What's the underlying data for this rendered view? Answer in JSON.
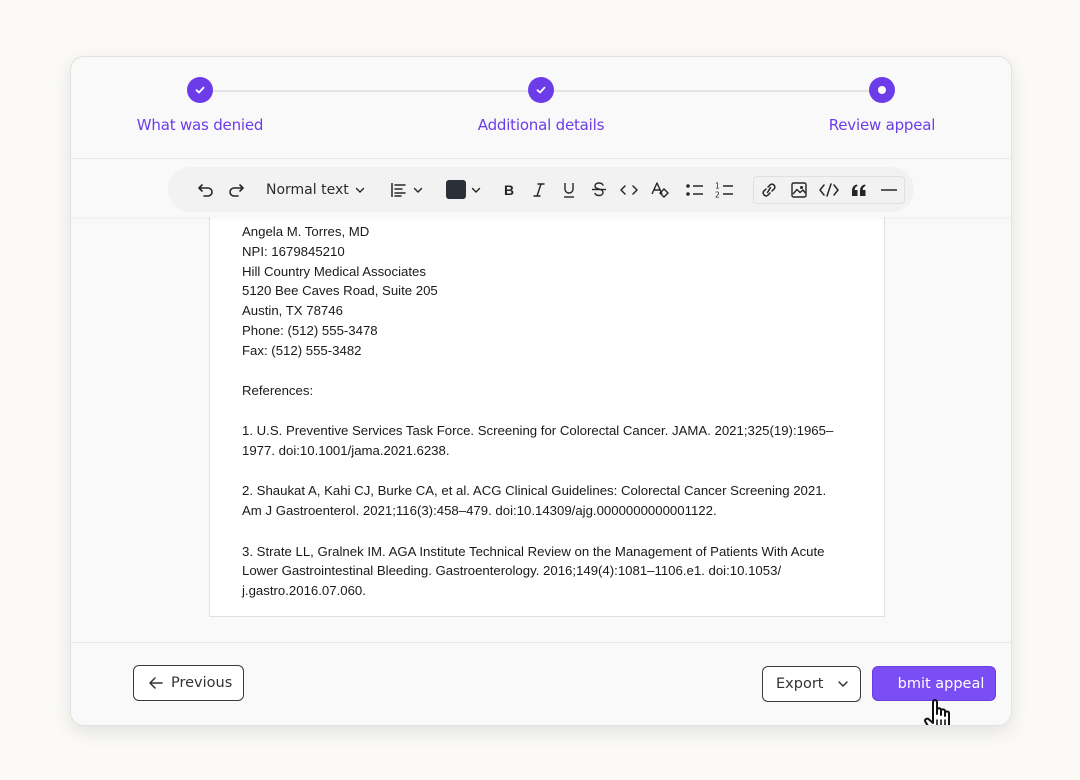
{
  "stepper": {
    "steps": [
      {
        "label": "What was denied",
        "state": "complete"
      },
      {
        "label": "Additional details",
        "state": "complete"
      },
      {
        "label": "Review appeal",
        "state": "current"
      }
    ],
    "accent_color": "#6c3ce9"
  },
  "toolbar": {
    "undo_icon": "undo-icon",
    "redo_icon": "redo-icon",
    "block_type": "Normal text",
    "align_icon": "align-left-icon",
    "text_color": "#2b2f38",
    "format_icons": [
      "bold-icon",
      "italic-icon",
      "underline-icon",
      "strikethrough-icon",
      "inline-code-icon",
      "clear-format-icon"
    ],
    "list_icons": [
      "bullet-list-icon",
      "numbered-list-icon"
    ],
    "insert_icons": [
      "link-icon",
      "image-icon",
      "code-block-icon",
      "blockquote-icon",
      "horizontal-rule-icon"
    ]
  },
  "document": {
    "signature": [
      "Angela M. Torres, MD",
      "NPI: 1679845210",
      "Hill Country Medical Associates",
      "5120 Bee Caves Road, Suite 205",
      "Austin, TX 78746",
      "Phone: (512) 555-3478",
      "Fax: (512) 555-3482"
    ],
    "references_heading": "References:",
    "references": [
      [
        "1. U.S. Preventive Services Task Force. Screening for Colorectal Cancer. JAMA. 2021;325(19):1965–",
        "1977. doi:10.1001/jama.2021.6238."
      ],
      [
        "2. Shaukat A, Kahi CJ, Burke CA, et al. ACG Clinical Guidelines: Colorectal Cancer Screening 2021.",
        "Am J Gastroenterol. 2021;116(3):458–479. doi:10.14309/ajg.0000000000001122."
      ],
      [
        "3. Strate LL, Gralnek IM. AGA Institute Technical Review on the Management of Patients With Acute",
        "Lower Gastrointestinal Bleeding. Gastroenterology. 2016;149(4):1081–1106.e1. doi:10.1053/",
        "j.gastro.2016.07.060."
      ]
    ]
  },
  "footer": {
    "previous_label": "Previous",
    "export_label": "Export",
    "submit_label": "Submit appeal",
    "submit_visible_label": "bmit appeal",
    "submit_color": "#7a4df5"
  }
}
